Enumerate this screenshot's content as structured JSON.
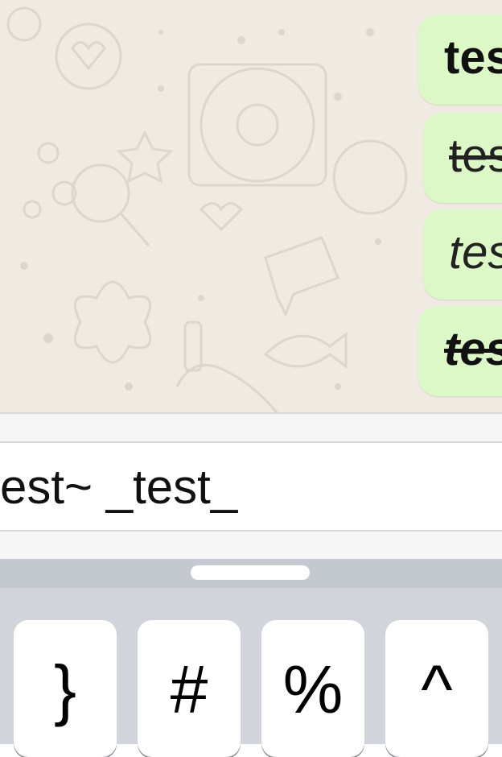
{
  "chat": {
    "messages": [
      {
        "text": "test",
        "style": "bold"
      },
      {
        "text": "test",
        "style": "strikethrough"
      },
      {
        "text": "test",
        "style": "italic"
      },
      {
        "text": "test",
        "style": "bold-italic-strikethrough"
      }
    ]
  },
  "composer": {
    "text": "est~ _test_"
  },
  "keyboard": {
    "keys": [
      "}",
      "#",
      "%",
      "^"
    ]
  },
  "colors": {
    "wallpaper": "#efeae2",
    "bubble": "#dcf8c6",
    "keyboard": "#d1d5db"
  }
}
